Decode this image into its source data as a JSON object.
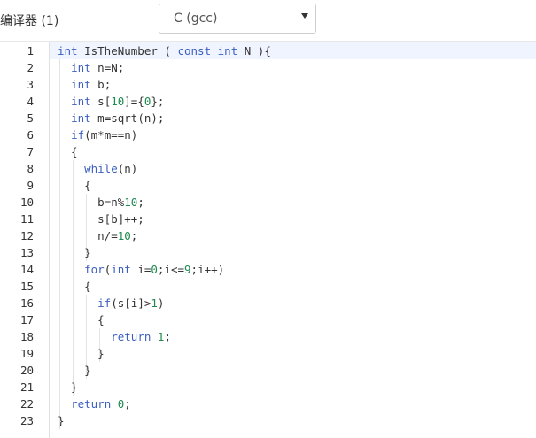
{
  "compiler": {
    "label": "编译器 (1)",
    "selected": "C (gcc)"
  },
  "editor": {
    "active_line": 1,
    "lines": [
      {
        "n": "1",
        "code": "int IsTheNumber ( const int N ){"
      },
      {
        "n": "2",
        "code": "  int n=N;"
      },
      {
        "n": "3",
        "code": "  int b;"
      },
      {
        "n": "4",
        "code": "  int s[10]={0};"
      },
      {
        "n": "5",
        "code": "  int m=sqrt(n);"
      },
      {
        "n": "6",
        "code": "  if(m*m==n)"
      },
      {
        "n": "7",
        "code": "  {"
      },
      {
        "n": "8",
        "code": "    while(n)"
      },
      {
        "n": "9",
        "code": "    {"
      },
      {
        "n": "10",
        "code": "      b=n%10;"
      },
      {
        "n": "11",
        "code": "      s[b]++;"
      },
      {
        "n": "12",
        "code": "      n/=10;"
      },
      {
        "n": "13",
        "code": "    }"
      },
      {
        "n": "14",
        "code": "    for(int i=0;i<=9;i++)"
      },
      {
        "n": "15",
        "code": "    {"
      },
      {
        "n": "16",
        "code": "      if(s[i]>1)"
      },
      {
        "n": "17",
        "code": "      {"
      },
      {
        "n": "18",
        "code": "        return 1;"
      },
      {
        "n": "19",
        "code": "      }"
      },
      {
        "n": "20",
        "code": "    }"
      },
      {
        "n": "21",
        "code": "  }"
      },
      {
        "n": "22",
        "code": "  return 0;"
      },
      {
        "n": "23",
        "code": "}"
      }
    ]
  },
  "colors": {
    "keyword": "#3b5fc0",
    "number": "#1d8a4f"
  }
}
